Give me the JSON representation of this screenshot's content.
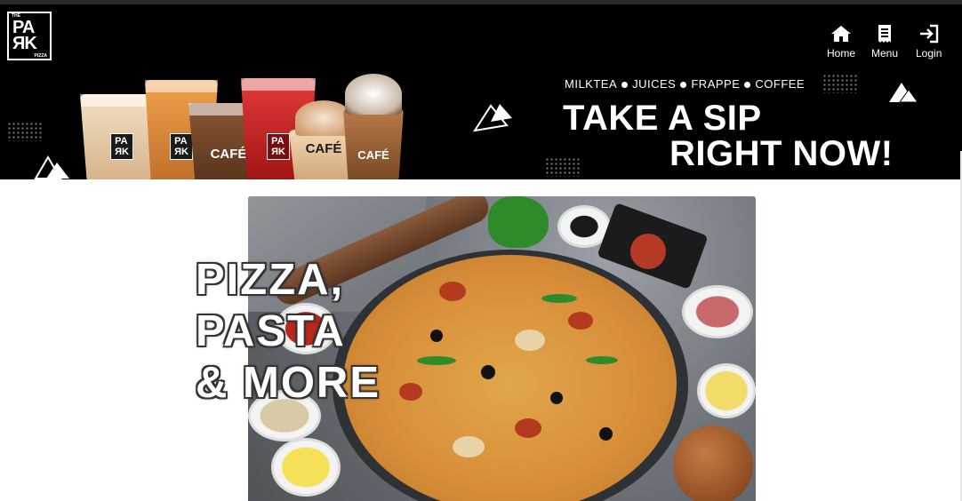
{
  "logo": {
    "the": "THE",
    "line1": "PA",
    "line2": "ЯK",
    "sub": "PIZZA"
  },
  "nav": [
    {
      "label": "Home",
      "icon": "home-icon"
    },
    {
      "label": "Menu",
      "icon": "receipt-icon"
    },
    {
      "label": "Login",
      "icon": "login-icon"
    }
  ],
  "banner": {
    "categories": [
      "MILKTEA",
      "JUICES",
      "FRAPPE",
      "COFFEE"
    ],
    "headline_line1": "TAKE A SIP",
    "headline_line2": "RIGHT NOW!",
    "cup_labels": {
      "park_a": "PA\nЯK",
      "cafe": "CAFÉ"
    }
  },
  "hero": {
    "line1": "PIZZA,",
    "line2": "PASTA",
    "line3": "& MORE"
  },
  "colors": {
    "banner_bg": "#000000",
    "nav_text": "#ffffff",
    "page_bg": "#ffffff"
  }
}
